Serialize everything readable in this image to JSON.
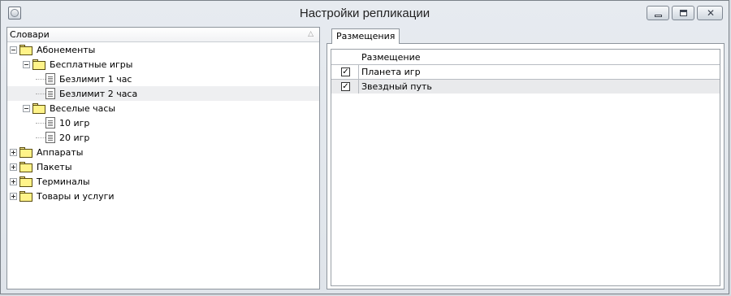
{
  "window": {
    "title": "Настройки репликации"
  },
  "left_panel": {
    "column_header": "Словари",
    "tree": [
      {
        "label": "Абонементы",
        "level": 0,
        "type": "folder",
        "expanded": true
      },
      {
        "label": "Бесплатные игры",
        "level": 1,
        "type": "folder",
        "expanded": true
      },
      {
        "label": "Безлимит 1 час",
        "level": 2,
        "type": "doc"
      },
      {
        "label": "Безлимит 2 часа",
        "level": 2,
        "type": "doc",
        "selected": true
      },
      {
        "label": "Веселые часы",
        "level": 1,
        "type": "folder",
        "expanded": true
      },
      {
        "label": "10 игр",
        "level": 2,
        "type": "doc"
      },
      {
        "label": "20 игр",
        "level": 2,
        "type": "doc"
      },
      {
        "label": "Аппараты",
        "level": 0,
        "type": "folder",
        "expanded": false
      },
      {
        "label": "Пакеты",
        "level": 0,
        "type": "folder",
        "expanded": false
      },
      {
        "label": "Терминалы",
        "level": 0,
        "type": "folder",
        "expanded": false
      },
      {
        "label": "Товары и услуги",
        "level": 0,
        "type": "folder",
        "expanded": false
      }
    ]
  },
  "right_panel": {
    "tab": "Размещения",
    "grid": {
      "header": "Размещение",
      "rows": [
        {
          "checked": true,
          "name": "Планета игр"
        },
        {
          "checked": true,
          "name": "Звездный путь"
        }
      ]
    }
  }
}
